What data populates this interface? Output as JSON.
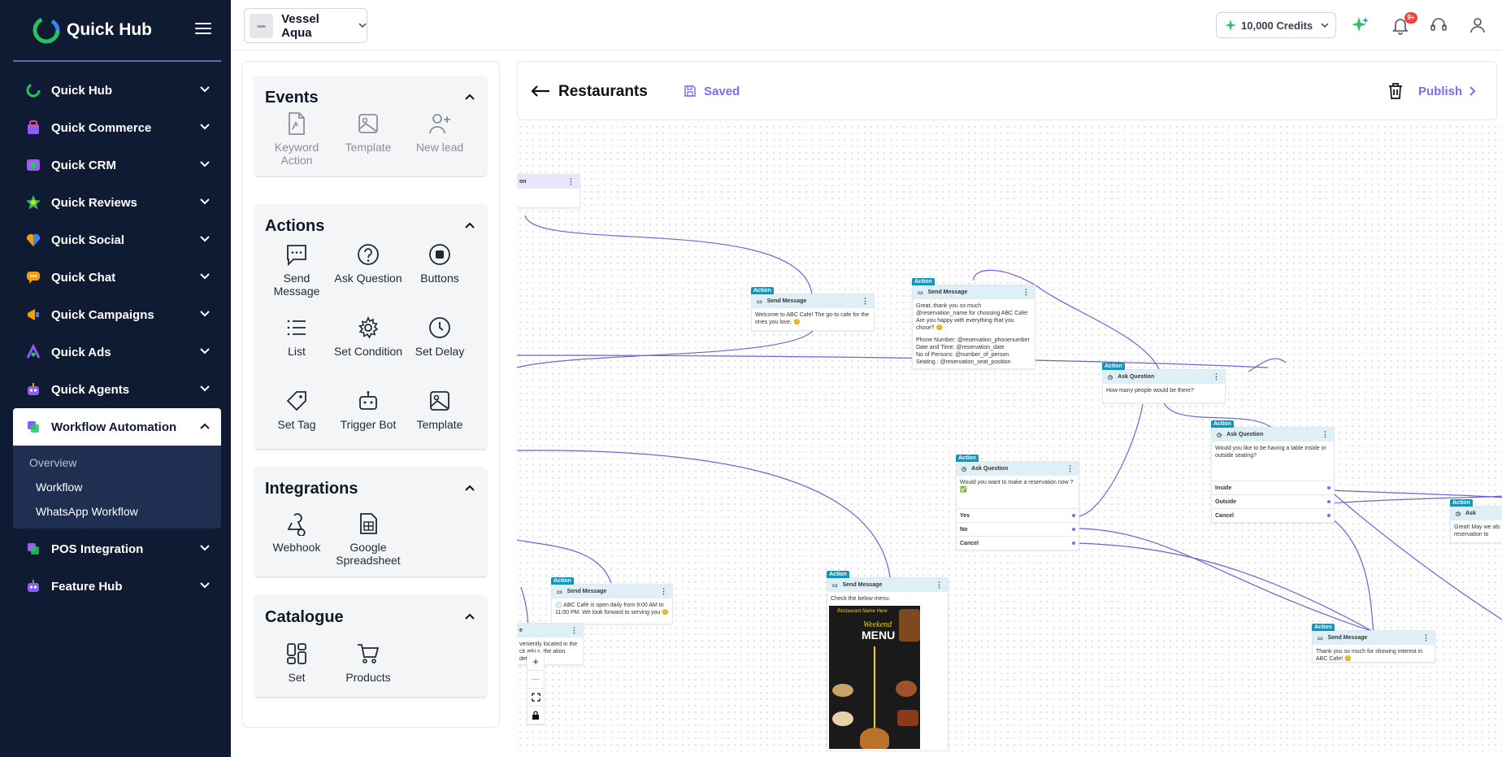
{
  "app": {
    "name": "Quick Hub"
  },
  "colors": {
    "sidebar_bg": "#0f1b33",
    "accent": "#7c6cf0",
    "action_tag": "#1593b8"
  },
  "sidebar": {
    "items": [
      {
        "label": "Quick Hub",
        "icon": "quick-hub-icon"
      },
      {
        "label": "Quick Commerce",
        "icon": "commerce-icon"
      },
      {
        "label": "Quick CRM",
        "icon": "crm-icon"
      },
      {
        "label": "Quick Reviews",
        "icon": "reviews-icon"
      },
      {
        "label": "Quick Social",
        "icon": "social-icon"
      },
      {
        "label": "Quick Chat",
        "icon": "chat-icon"
      },
      {
        "label": "Quick Campaigns",
        "icon": "campaigns-icon"
      },
      {
        "label": "Quick Ads",
        "icon": "ads-icon"
      },
      {
        "label": "Quick Agents",
        "icon": "agents-icon"
      },
      {
        "label": "Workflow Automation",
        "icon": "workflow-icon"
      },
      {
        "label": "POS Integration",
        "icon": "pos-icon"
      },
      {
        "label": "Feature Hub",
        "icon": "feature-hub-icon"
      }
    ],
    "sub_items": [
      "Overview",
      "Workflow",
      "WhatsApp Workflow"
    ]
  },
  "header": {
    "business_name": "Vessel Aqua",
    "credits": "10,000 Credits",
    "notification_count": "9+"
  },
  "palette": {
    "events": {
      "title": "Events",
      "items": [
        "Keyword Action",
        "Template",
        "New lead"
      ]
    },
    "actions": {
      "title": "Actions",
      "items": [
        "Send Message",
        "Ask Question",
        "Buttons",
        "List",
        "Set Condition",
        "Set Delay",
        "Set Tag",
        "Trigger Bot",
        "Template"
      ]
    },
    "integrations": {
      "title": "Integrations",
      "items": [
        "Webhook",
        "Google Spreadsheet"
      ]
    },
    "catalogue": {
      "title": "Catalogue",
      "items": [
        "Set",
        "Products"
      ]
    }
  },
  "workflow": {
    "title": "Restaurants",
    "status": "Saved",
    "publish": "Publish"
  },
  "nodes": {
    "tag": "Action",
    "n0": {
      "title": "on"
    },
    "n1": {
      "title": "Send Message",
      "body": "Welcome to ABC Cafe! The go-to cafe for the ones you love. 😊"
    },
    "n2": {
      "title": "Send Message",
      "body": "Great, thank you so much @reservation_name for choosing ABC Cafe! Are you happy with everything that you chose? 😊",
      "details": [
        "Phone Number: @reservation_phonenumber",
        "Date and Time: @reservation_date",
        "No of Persons: @number_of_person",
        "Seating : @reservation_seat_position"
      ]
    },
    "n3": {
      "title": "Ask Question",
      "body": "How many people would be there?"
    },
    "n4": {
      "title": "Ask Question",
      "body": "Would you like to be having a table inside or outside seating?",
      "options": [
        "Inside",
        "Outside",
        "Cancel"
      ]
    },
    "n5": {
      "title": "Ask Question",
      "body": "Would you want to make a reservation now ? ✅",
      "options": [
        "Yes",
        "No",
        "Cancel"
      ]
    },
    "n6": {
      "title": "Ask",
      "body": "Great! May we als the reservation to"
    },
    "n7": {
      "title": "Send Message",
      "body": "🕘 ABC Café is open daily from 9:00 AM to 11:00 PM. We look forward to serving you 😊"
    },
    "n8": {
      "title": "e",
      "body": "veniently located in the cit arki s. the ation details"
    },
    "n9": {
      "title": "Send Message",
      "body": "Check the below menu.",
      "menu_heading": "Weekend",
      "menu_title": "MENU",
      "menu_sub": "Restaurant Name Here"
    },
    "n10": {
      "title": "Send Message",
      "body": "Thank you so much for showing interest in ABC Cafe! 😊"
    }
  },
  "zoom": {
    "plus": "+",
    "minus": "—"
  }
}
